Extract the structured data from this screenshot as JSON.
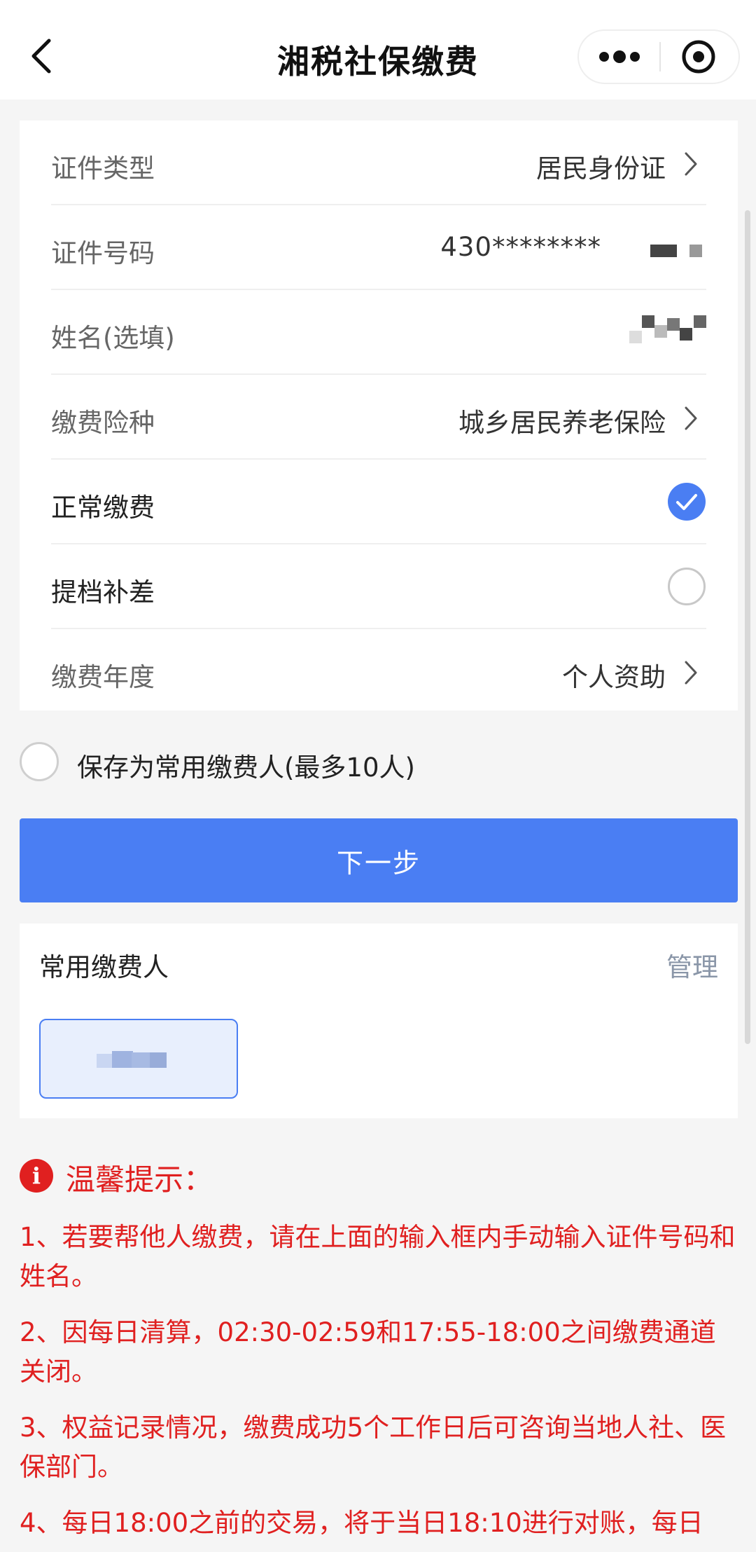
{
  "header": {
    "title": "湘税社保缴费"
  },
  "form": {
    "id_type": {
      "label": "证件类型",
      "value": "居民身份证"
    },
    "id_number": {
      "label": "证件号码",
      "value": "430********"
    },
    "name": {
      "label": "姓名(选填)"
    },
    "insurance_type": {
      "label": "缴费险种",
      "value": "城乡居民养老保险"
    },
    "normal_payment": {
      "label": "正常缴费",
      "checked": true
    },
    "upgrade_payment": {
      "label": "提档补差",
      "checked": false
    },
    "payment_year": {
      "label": "缴费年度",
      "value": "个人资助"
    }
  },
  "save_payer": {
    "label": "保存为常用缴费人(最多10人)",
    "checked": false
  },
  "next_button": {
    "label": "下一步"
  },
  "frequent_payers": {
    "title": "常用缴费人",
    "manage_label": "管理"
  },
  "tips": {
    "title": "温馨提示：",
    "items": [
      "1、若要帮他人缴费，请在上面的输入框内手动输入证件号码和姓名。",
      "2、因每日清算，02:30-02:59和17:55-18:00之间缴费通道关闭。",
      "3、权益记录情况，缴费成功5个工作日后可咨询当地人社、医保部门。",
      "4、每日18:00之前的交易，将于当日18:10进行对账，每日"
    ]
  },
  "colors": {
    "accent": "#4a7ef3",
    "warning": "#e02020",
    "background": "#f5f5f5"
  },
  "icons": {
    "back": "chevron-left-icon",
    "more": "more-dots-icon",
    "close": "target-circle-icon",
    "chevron": "chevron-right-icon",
    "check": "check-circle-icon",
    "info": "info-icon"
  }
}
